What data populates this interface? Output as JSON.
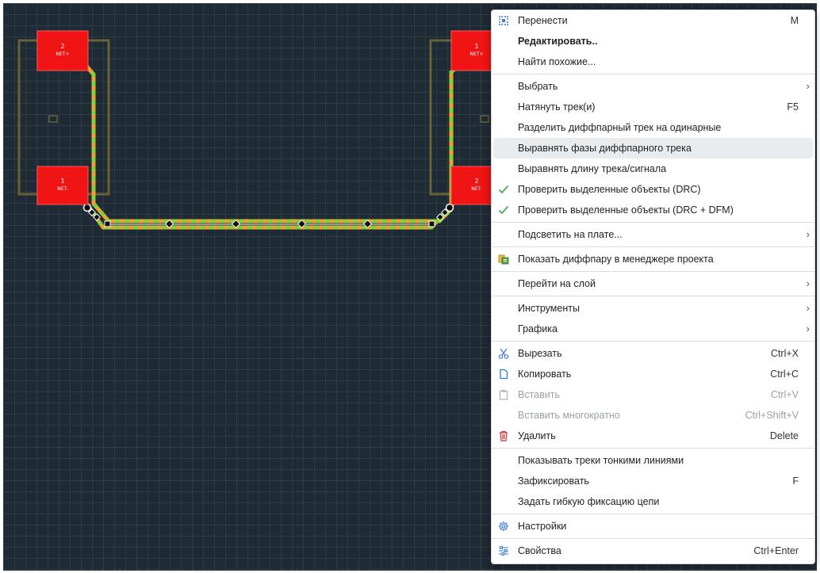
{
  "pcb": {
    "pads": [
      {
        "number": "2",
        "net": "NET+"
      },
      {
        "number": "1",
        "net": "NET-"
      },
      {
        "number": "1",
        "net": "NET+"
      },
      {
        "number": "2",
        "net": "NET-"
      }
    ]
  },
  "context_menu": {
    "items": [
      {
        "label": "Перенести",
        "shortcut": "M",
        "icon": "move-icon"
      },
      {
        "label": "Редактировать..",
        "bold": true
      },
      {
        "label": "Найти похожие..."
      },
      {
        "separator": true
      },
      {
        "label": "Выбрать",
        "submenu": true
      },
      {
        "label": "Натянуть трек(и)",
        "shortcut": "F5"
      },
      {
        "label": "Разделить диффпарный трек на одинарные"
      },
      {
        "label": "Выравнять фазы диффпарного трека",
        "highlighted": true
      },
      {
        "label": "Выравнять длину трека/сигнала"
      },
      {
        "label": "Проверить выделенные объекты (DRC)",
        "icon": "checkmark-icon"
      },
      {
        "label": "Проверить выделенные объекты (DRC + DFM)",
        "icon": "checkmark-icon"
      },
      {
        "separator": true
      },
      {
        "label": "Подсветить на плате...",
        "submenu": true
      },
      {
        "separator": true
      },
      {
        "label": "Показать диффпару в менеджере проекта",
        "icon": "project-manager-icon"
      },
      {
        "separator": true
      },
      {
        "label": "Перейти на слой",
        "submenu": true
      },
      {
        "separator": true
      },
      {
        "label": "Инструменты",
        "submenu": true
      },
      {
        "label": "Графика",
        "submenu": true
      },
      {
        "separator": true
      },
      {
        "label": "Вырезать",
        "shortcut": "Ctrl+X",
        "icon": "scissors-icon"
      },
      {
        "label": "Копировать",
        "shortcut": "Ctrl+C",
        "icon": "copy-icon"
      },
      {
        "label": "Вставить",
        "shortcut": "Ctrl+V",
        "icon": "paste-icon",
        "disabled": true
      },
      {
        "label": "Вставить многократно",
        "shortcut": "Ctrl+Shift+V",
        "disabled": true
      },
      {
        "label": "Удалить",
        "shortcut": "Delete",
        "icon": "trash-icon"
      },
      {
        "separator": true
      },
      {
        "label": "Показывать треки тонкими линиями"
      },
      {
        "label": "Зафиксировать",
        "shortcut": "F"
      },
      {
        "label": "Задать гибкую фиксацию цепи"
      },
      {
        "separator": true
      },
      {
        "label": "Настройки",
        "icon": "gear-icon"
      },
      {
        "separator": true
      },
      {
        "label": "Свойства",
        "shortcut": "Ctrl+Enter",
        "icon": "sliders-icon"
      }
    ]
  },
  "colors": {
    "canvas_bg": "#1e2a34",
    "grid": "#2e3b46",
    "pad": "#f01414",
    "trace_orange": "#f0a030",
    "trace_green": "#7fd23c",
    "outline": "#6b6136",
    "menu_highlight": "#e9ecef",
    "check_green": "#4caf50",
    "trash_red": "#d32f2f",
    "icon_blue": "#3a7bd5"
  }
}
